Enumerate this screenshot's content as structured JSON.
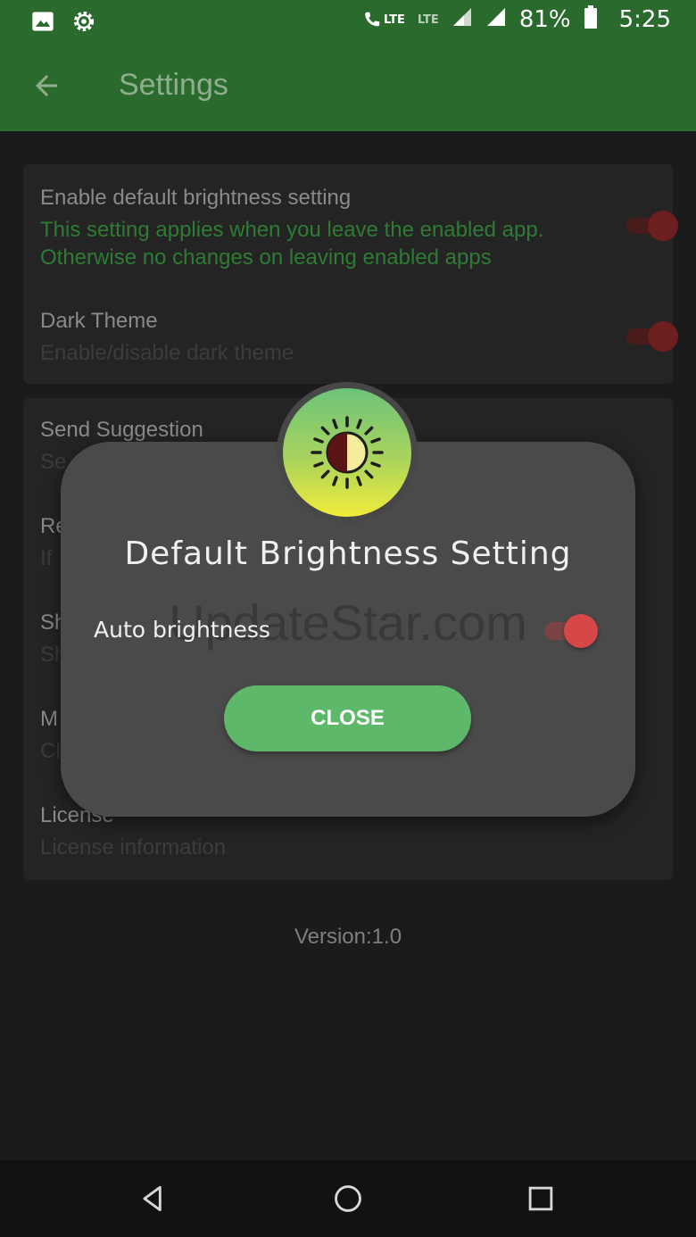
{
  "status_bar": {
    "left_icons": [
      "image-icon",
      "gear-icon"
    ],
    "network_1": "LTE",
    "network_2": "LTE",
    "battery": "81%",
    "time": "5:25"
  },
  "app_bar": {
    "title": "Settings"
  },
  "settings_group_1": [
    {
      "title": "Enable default brightness setting",
      "summary": "This setting applies when you leave the enabled app. Otherwise no changes on leaving enabled apps"
    },
    {
      "title": "Dark Theme",
      "summary": "Enable/disable dark theme"
    }
  ],
  "settings_group_2": [
    {
      "title": "Send Suggestion",
      "summary": "Se"
    },
    {
      "title": "Re",
      "summary": "If"
    },
    {
      "title": "Sh",
      "summary": "Sh"
    },
    {
      "title": "M",
      "summary": "Cl"
    },
    {
      "title": "License",
      "summary": "License information"
    }
  ],
  "version": "Version:1.0",
  "dialog": {
    "title": "Default Brightness Setting",
    "auto_label": "Auto brightness",
    "close_label": "CLOSE",
    "watermark": "UpdateStar.com"
  },
  "colors": {
    "app_bar": "#2b6a2d",
    "accent_green": "#5db86a",
    "switch_red": "#d64848"
  }
}
